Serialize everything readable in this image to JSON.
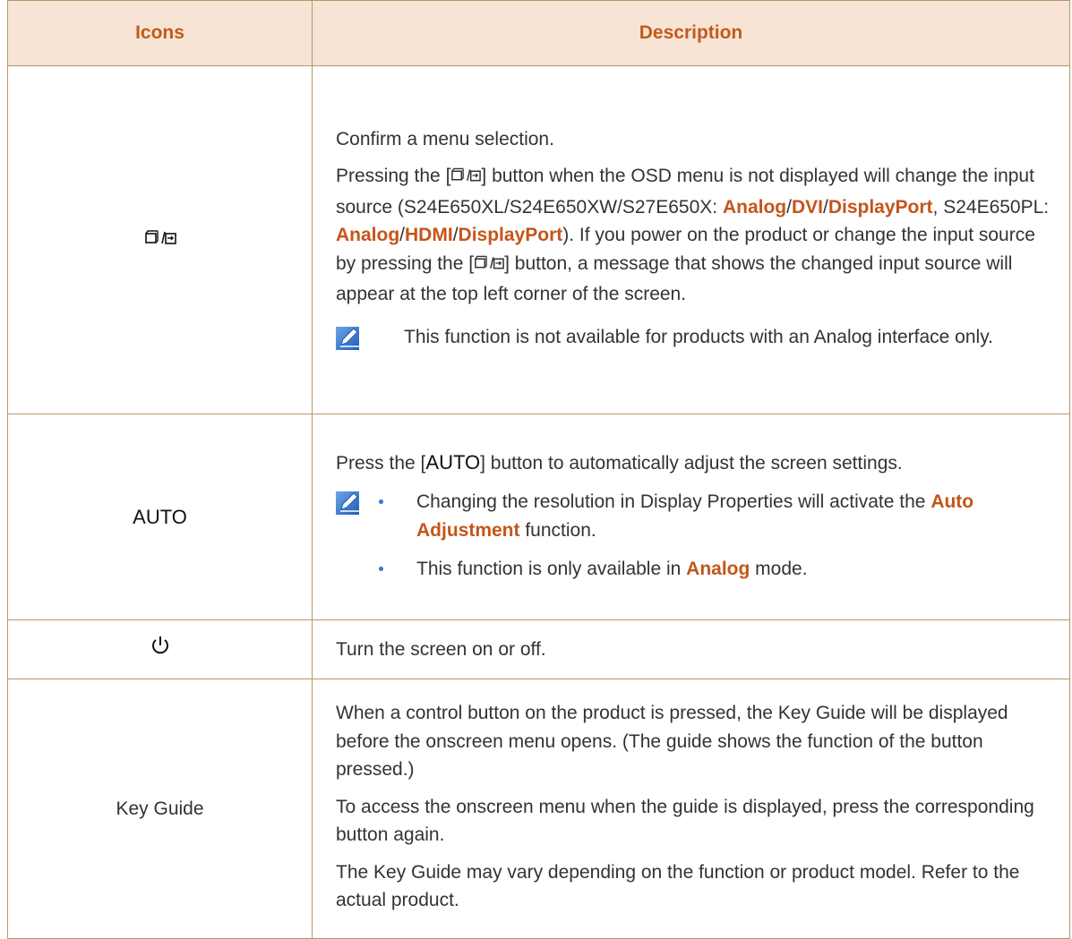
{
  "table": {
    "headers": {
      "icons": "Icons",
      "description": "Description"
    },
    "rows": [
      {
        "icon_symbol": "[□/→]",
        "desc": {
          "p1": "Confirm a menu selection.",
          "p2a": "Pressing the [",
          "p2b": "] button when the OSD menu is not displayed will change the input source (S24E650XL/S24E650XW/S27E650X: ",
          "p2_analog": "Analog",
          "p2_sep1": "/",
          "p2_dvi": "DVI",
          "p2_sep2": "/",
          "p2_dp": "DisplayPort",
          "p2c": ", S24E650PL: ",
          "p2_analog2": "Analog",
          "p2_sep3": "/",
          "p2_hdmi": "HDMI",
          "p2_sep4": "/",
          "p2_dp2": "DisplayPort",
          "p2d": "). If you power on the product or change the input source by pressing the [",
          "p2e": "] button, a message that shows the changed input source will appear at the top left corner of the screen.",
          "note": "This function is not available for products with an Analog interface only."
        }
      },
      {
        "icon_label": "AUTO",
        "desc": {
          "p1a": "Press the [",
          "p1_auto": "AUTO",
          "p1b": "] button to automatically adjust the screen settings.",
          "b1a": "Changing the resolution in Display Properties will activate the ",
          "b1_hl": "Auto Adjustment",
          "b1b": " function.",
          "b2a": "This function is only available in ",
          "b2_hl": "Analog",
          "b2b": " mode."
        }
      },
      {
        "icon_symbol": "power",
        "desc": {
          "p1": "Turn the screen on or off."
        }
      },
      {
        "icon_label": "Key Guide",
        "desc": {
          "p1": "When a control button on the product is pressed, the Key Guide will be displayed before the onscreen menu opens. (The guide shows the function of the button pressed.)",
          "p2": "To access the onscreen menu when the guide is displayed, press the corresponding button again.",
          "p3": "The Key Guide may vary depending on the function or product model. Refer to the actual product."
        }
      }
    ]
  },
  "colors": {
    "accent": "#c4551a",
    "header_bg": "#f7e4d4",
    "border": "#b8956a",
    "note_blue": "#2f6fd0"
  },
  "icons": [
    "source-enter-icon",
    "power-icon",
    "note-pencil-icon"
  ]
}
